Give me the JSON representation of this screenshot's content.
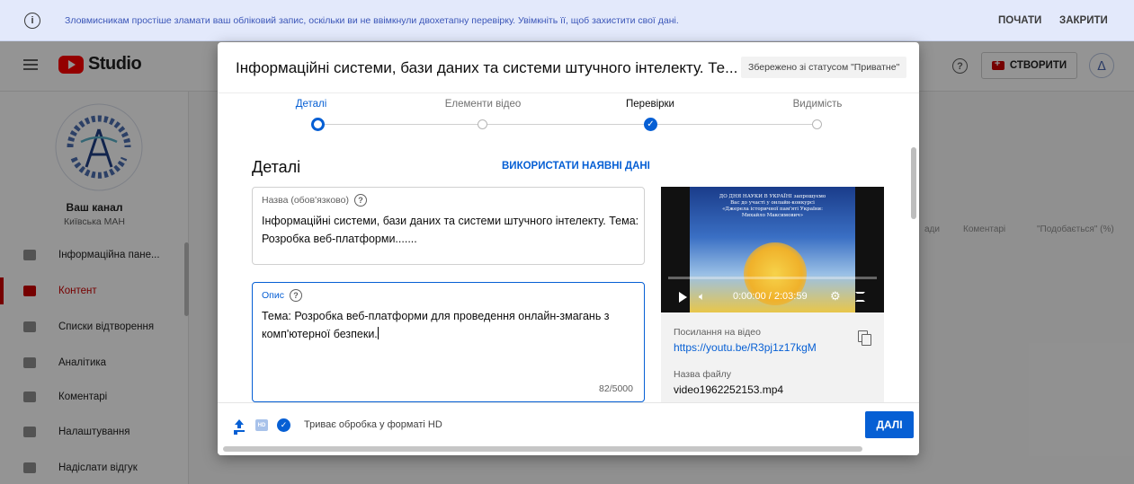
{
  "banner": {
    "message": "Зловмисникам простіше зламати ваш обліковий запис, оскільки ви не ввімкнули двохетапну перевірку. Увімкніть її, щоб захистити свої дані.",
    "start_label": "ПОЧАТИ",
    "close_label": "ЗАКРИТИ",
    "info_icon": "i"
  },
  "topbar": {
    "logo_text": "Studio",
    "help_icon": "?",
    "create_label": "СТВОРИТИ",
    "avatar_glyph": "ᐃ"
  },
  "sidebar": {
    "channel_label": "Ваш канал",
    "channel_name": "Київська МАН",
    "items": [
      {
        "label": "Інформаційна пане..."
      },
      {
        "label": "Контент"
      },
      {
        "label": "Списки відтворення"
      },
      {
        "label": "Аналітика"
      },
      {
        "label": "Коментарі"
      },
      {
        "label": "Налаштування"
      },
      {
        "label": "Надіслати відгук"
      }
    ]
  },
  "background": {
    "col_partial": "ади",
    "col_comments": "Коментарі",
    "col_likes": "\"Подобається\" (%)"
  },
  "dialog": {
    "title": "Інформаційні системи, бази даних та системи штучного інтелекту. Те...",
    "saved_status": "Збережено зі статусом \"Приватне\"",
    "steps": [
      {
        "label": "Деталі",
        "state": "current"
      },
      {
        "label": "Елементи відео",
        "state": "todo"
      },
      {
        "label": "Перевірки",
        "state": "done"
      },
      {
        "label": "Видимість",
        "state": "todo"
      }
    ],
    "section_title": "Деталі",
    "reuse_label": "ВИКОРИСТАТИ НАЯВНІ ДАНІ",
    "title_field": {
      "label": "Назва (обов'язково)",
      "value": "Інформаційні системи, бази даних та системи штучного інтелекту. Тема: Розробка веб-платформи......."
    },
    "description_field": {
      "label": "Опис",
      "value": "Тема: Розробка веб-платформи для проведення онлайн-змагань з комп'ютерної безпеки.",
      "counter": "82/5000"
    },
    "video": {
      "time": "0:00:00 / 2:03:59",
      "thumb_caption": "ДО ДНЯ НАУКИ В УКРАЇНІ запрошуємо Вас до участі у онлайн-конкурсі «Джерела історичної пам'яті України: Михайло Максимович»",
      "link_label": "Посилання на відео",
      "link": "https://youtu.be/R3pj1z17kgM",
      "filename_label": "Назва файлу",
      "filename": "video1962252153.mp4"
    },
    "footer": {
      "hd_label": "HD",
      "status": "Триває обробка у форматі HD",
      "next_label": "ДАЛІ"
    }
  },
  "colors": {
    "accent": "#065fd4",
    "brand_red": "#ff0000",
    "active_nav": "#cc0000",
    "banner_bg": "#e3e9fb"
  }
}
